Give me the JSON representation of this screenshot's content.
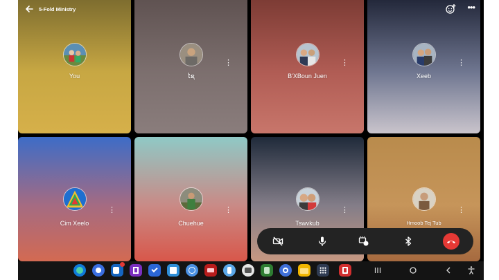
{
  "header": {
    "title": "5-Fold Ministry"
  },
  "participants": [
    {
      "name": "You",
      "avatar": "photo"
    },
    {
      "name": "ໄຊ",
      "avatar": "photo"
    },
    {
      "name": "B'XBoun Juen",
      "avatar": "photo"
    },
    {
      "name": "Xeeb",
      "avatar": "photo"
    },
    {
      "name": "Cim Xeelo",
      "avatar": "pyramid-graphic"
    },
    {
      "name": "Chuehue",
      "avatar": "photo"
    },
    {
      "name": "Tswvkub",
      "avatar": "photo"
    },
    {
      "name": "Hmoob Tej Tub",
      "avatar": "photo"
    }
  ],
  "tile_colors": {
    "you": [
      "#7a6a2e",
      "#c7a743",
      "#d6b04a"
    ],
    "xai": [
      "#5e5150",
      "#7c6f6e",
      "#8a7d7c"
    ],
    "bxboun": [
      "#7a3a33",
      "#b05c54",
      "#c8766b"
    ],
    "xeeb": [
      "#1f2436",
      "#6f7690",
      "#c9c4cc"
    ],
    "cim": [
      "#3d6cc7",
      "#a56b82",
      "#d36a52"
    ],
    "chuehue": [
      "#8fc9c6",
      "#c98a86",
      "#d8574a"
    ],
    "tswvkub": [
      "#1f2a3a",
      "#837d88",
      "#c69882"
    ],
    "hmoob": [
      "#b98b4c",
      "#c6955a",
      "#a66a3f"
    ]
  },
  "controls": {
    "icons": [
      "video-off-icon",
      "microphone-icon",
      "effects-icon",
      "bluetooth-icon",
      "end-call-icon"
    ],
    "end_call_color": "#e53935"
  },
  "taskbar": {
    "apps": [
      "edge-icon",
      "chrome-icon",
      "outlook-icon",
      "onenote-icon",
      "todo-icon",
      "save-icon",
      "safari-icon",
      "bible-icon",
      "phone-icon",
      "hub-icon",
      "music-icon",
      "settings-icon",
      "files-icon",
      "app-grid-icon",
      "pdf-icon"
    ],
    "nav": [
      "recents-icon",
      "home-icon",
      "back-icon",
      "accessibility-icon"
    ]
  }
}
